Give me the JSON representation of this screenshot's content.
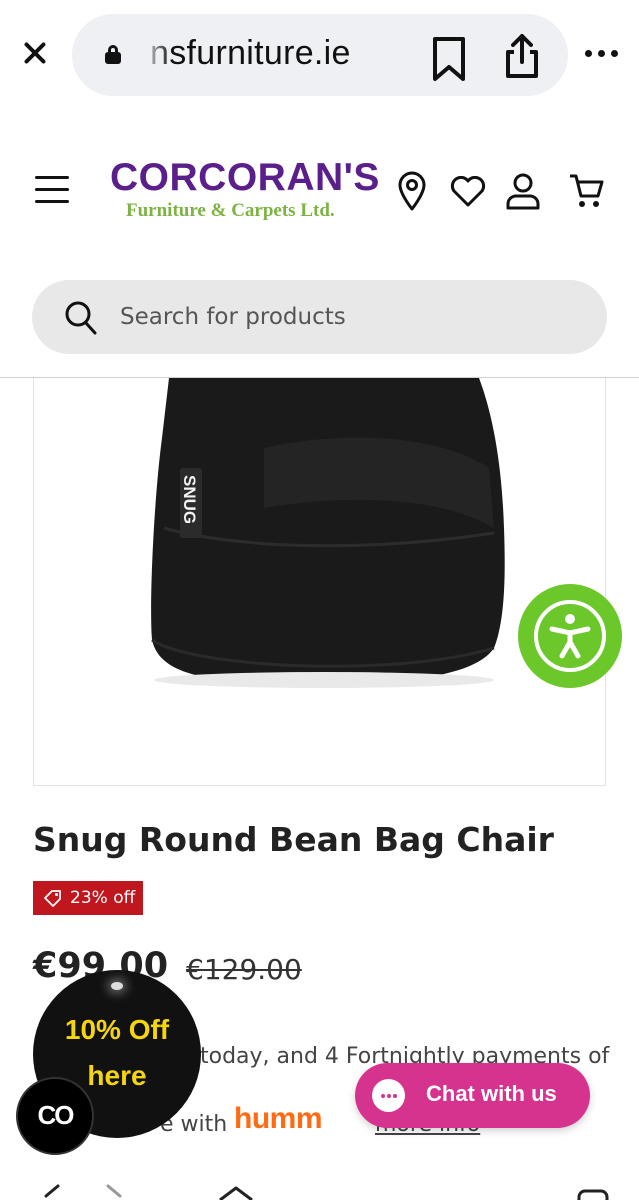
{
  "browser": {
    "url": "nsfurniture.ie",
    "close_icon": "close-icon",
    "bookmark_icon": "bookmark-icon",
    "share_icon": "share-icon",
    "more_icon": "more-dots-icon"
  },
  "header": {
    "logo_main": "CORCORAN'S",
    "logo_sub": "Furniture & Carpets Ltd.",
    "icons": [
      "menu-icon",
      "location-pin-icon",
      "heart-icon",
      "user-icon",
      "cart-icon"
    ]
  },
  "search": {
    "placeholder": "Search for products"
  },
  "product": {
    "image_label": "SNUG",
    "title": "Snug Round Bean Bag Chair",
    "discount_badge": "23% off",
    "price": "€99.00",
    "was_price": "€129.00",
    "payment_line": "today, and 4 Fortnightly payments of",
    "payment_with": "e with",
    "provider": "humm",
    "more_info": "more info"
  },
  "promo": {
    "line1": "10% Off",
    "line2": "here",
    "co_label": "CO"
  },
  "chat": {
    "label": "Chat with us"
  },
  "colors": {
    "brand_purple": "#5a1f8a",
    "brand_green": "#7cb342",
    "badge_red": "#c0161d",
    "chat_pink": "#d6338f",
    "a11y_green": "#6cc72b",
    "humm_orange": "#ff6a13",
    "promo_yellow": "#f6d60a"
  }
}
